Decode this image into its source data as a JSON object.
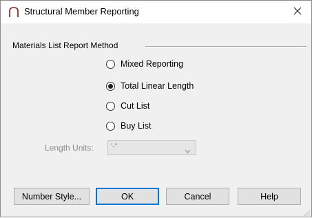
{
  "dialog": {
    "title": "Structural Member Reporting",
    "close_glyph": "✕"
  },
  "group": {
    "label": "Materials List Report Method"
  },
  "radios": [
    {
      "label": "Mixed Reporting",
      "checked": false
    },
    {
      "label": "Total Linear Length",
      "checked": true
    },
    {
      "label": "Cut List",
      "checked": false
    },
    {
      "label": "Buy List",
      "checked": false
    }
  ],
  "length_units": {
    "label": "Length Units:",
    "value": "'-\"",
    "enabled": false
  },
  "buttons": {
    "number_style": "Number Style...",
    "ok": "OK",
    "cancel": "Cancel",
    "help": "Help"
  },
  "icons": {
    "app": "chief-architect-roof-icon",
    "close": "close-icon",
    "dropdown": "chevron-down-icon",
    "resize": "resize-grip-icon"
  },
  "colors": {
    "default_button_border": "#0078d7",
    "app_icon": "#8b1a1a",
    "disabled_text": "#8d8d8d"
  }
}
